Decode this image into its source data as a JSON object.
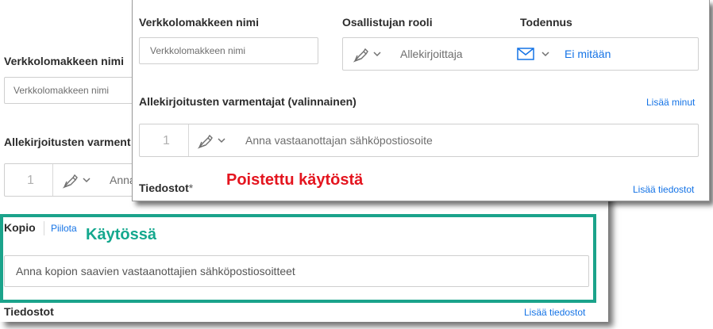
{
  "back": {
    "form_name_label": "Verkkolomakkeen nimi",
    "form_name_placeholder": "Verkkolomakkeen nimi",
    "verifiers_label": "Allekirjoitusten varment",
    "verifier_index": "1",
    "verifier_placeholder": "Anna",
    "cc_tab": "Kopio",
    "hide_link": "Piilota",
    "enabled_callout": "Käytössä",
    "cc_placeholder": "Anna kopion saavien vastaanottajien sähköpostiosoitteet",
    "files_label": "Tiedostot",
    "add_files_link": "Lisää tiedostot"
  },
  "front": {
    "form_name_label": "Verkkolomakkeen nimi",
    "form_name_placeholder": "Verkkolomakkeen nimi",
    "role_label": "Osallistujan rooli",
    "role_value": "Allekirjoittaja",
    "auth_label": "Todennus",
    "auth_value": "Ei mitään",
    "verifiers_label": "Allekirjoitusten varmentajat (valinnainen)",
    "add_more_link": "Lisää minut",
    "verifier_index": "1",
    "verifier_placeholder": "Anna vastaanottajan sähköpostiosoite",
    "files_label": "Tiedostot",
    "required_mark": "*",
    "disabled_callout": "Poistettu käytöstä",
    "add_files_link": "Lisää tiedostot"
  },
  "colors": {
    "link": "#1473e6",
    "disabled_callout": "#e4151f",
    "enabled_callout": "#14a88e",
    "highlight_border": "#1ba38b"
  },
  "icons": {
    "pen": "pen-icon",
    "chevron": "chevron-down-icon",
    "mail": "mail-icon"
  }
}
